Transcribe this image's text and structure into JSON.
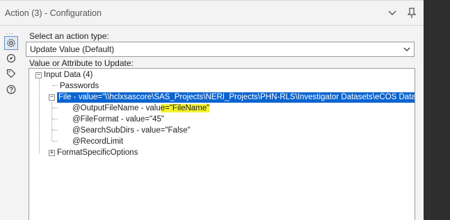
{
  "window": {
    "title": "Action (3) - Configuration"
  },
  "sidebar": {
    "dots": "...",
    "icons": [
      "gear-icon",
      "compass-icon",
      "tag-icon",
      "help-icon"
    ]
  },
  "form": {
    "action_type_label": "Select an action type:",
    "action_type_value": "Update Value (Default)",
    "attribute_label": "Value or Attribute to Update:"
  },
  "tree": {
    "root": {
      "label": "Input Data (4)",
      "expander": "−"
    },
    "passwords": {
      "label": "Passwords"
    },
    "file": {
      "label": "File - value=\"\\\\hclxsascore\\SAS_Projects\\NERI_Projects\\PHN-RLS\\Investigator Datasets\\eCOS Dataset",
      "expander": "−"
    },
    "output_filename": {
      "label_prefix": "@OutputFileName - valu",
      "label_highlight": "e=\"FileName\""
    },
    "file_format": {
      "label": "@FileFormat - value=\"45\""
    },
    "search_subdirs": {
      "label": "@SearchSubDirs - value=\"False\""
    },
    "record_limit": {
      "label": "@RecordLimit"
    },
    "format_specific": {
      "label": "FormatSpecificOptions",
      "expander": "+"
    }
  },
  "colors": {
    "selection": "#0a64d0",
    "highlight": "#f4f32d",
    "panel_bg": "#f3f3f3",
    "dark_bg": "#2e2e2e"
  }
}
